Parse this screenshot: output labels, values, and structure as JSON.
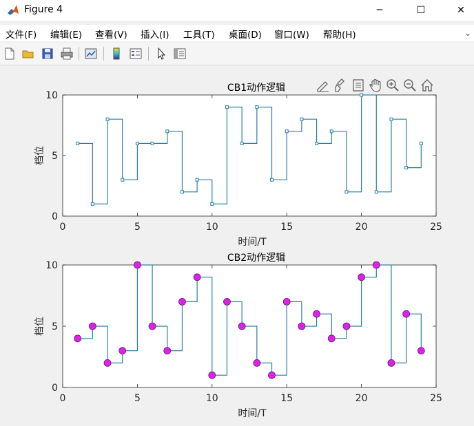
{
  "window": {
    "title": "Figure 4",
    "minimize_glyph": "─",
    "maximize_glyph": "☐",
    "close_glyph": "✕"
  },
  "menu": {
    "items": [
      {
        "label": "文件(F)",
        "name": "menu-file"
      },
      {
        "label": "编辑(E)",
        "name": "menu-edit"
      },
      {
        "label": "查看(V)",
        "name": "menu-view"
      },
      {
        "label": "插入(I)",
        "name": "menu-insert"
      },
      {
        "label": "工具(T)",
        "name": "menu-tools"
      },
      {
        "label": "桌面(D)",
        "name": "menu-desktop"
      },
      {
        "label": "窗口(W)",
        "name": "menu-window"
      },
      {
        "label": "帮助(H)",
        "name": "menu-help"
      }
    ]
  },
  "toolbar": {
    "icons": [
      "new-file-icon",
      "open-folder-icon",
      "save-icon",
      "print-icon",
      "link-plot-icon",
      "insert-colorbar-icon",
      "insert-legend-icon",
      "pointer-icon",
      "property-inspector-icon"
    ]
  },
  "axes_toolbar": {
    "icons": [
      "brush-edit-icon",
      "data-brush-icon",
      "data-tips-icon",
      "pan-icon",
      "zoom-in-icon",
      "zoom-out-icon",
      "home-restore-icon"
    ]
  },
  "colors": {
    "line": "#2a7fa6",
    "marker_cb2": "#e020ea",
    "axes_bg": "#ffffff",
    "axis_text": "#262626"
  },
  "chart_data": [
    {
      "type": "line",
      "style": "stairs",
      "title": "CB1动作逻辑",
      "xlabel": "时间/T",
      "ylabel": "档位",
      "xlim": [
        0,
        25
      ],
      "ylim": [
        0,
        10
      ],
      "xticks": [
        0,
        5,
        10,
        15,
        20,
        25
      ],
      "yticks": [
        0,
        5,
        10
      ],
      "marker": "square",
      "x": [
        1,
        2,
        3,
        4,
        5,
        6,
        7,
        8,
        9,
        10,
        11,
        12,
        13,
        14,
        15,
        16,
        17,
        18,
        19,
        20,
        21,
        22,
        23,
        24
      ],
      "values": [
        6,
        1,
        8,
        3,
        6,
        6,
        7,
        2,
        3,
        1,
        9,
        6,
        9,
        3,
        7,
        8,
        6,
        7,
        2,
        10,
        2,
        8,
        4,
        6
      ]
    },
    {
      "type": "line",
      "style": "stairs",
      "title": "CB2动作逻辑",
      "xlabel": "时间/T",
      "ylabel": "档位",
      "xlim": [
        0,
        25
      ],
      "ylim": [
        0,
        10
      ],
      "xticks": [
        0,
        5,
        10,
        15,
        20,
        25
      ],
      "yticks": [
        0,
        5,
        10
      ],
      "marker": "circle",
      "x": [
        1,
        2,
        3,
        4,
        5,
        6,
        7,
        8,
        9,
        10,
        11,
        12,
        13,
        14,
        15,
        16,
        17,
        18,
        19,
        20,
        21,
        22,
        23,
        24
      ],
      "values": [
        4,
        5,
        2,
        3,
        10,
        5,
        3,
        7,
        9,
        1,
        7,
        5,
        2,
        1,
        7,
        5,
        6,
        4,
        5,
        9,
        10,
        2,
        6,
        3
      ]
    }
  ]
}
